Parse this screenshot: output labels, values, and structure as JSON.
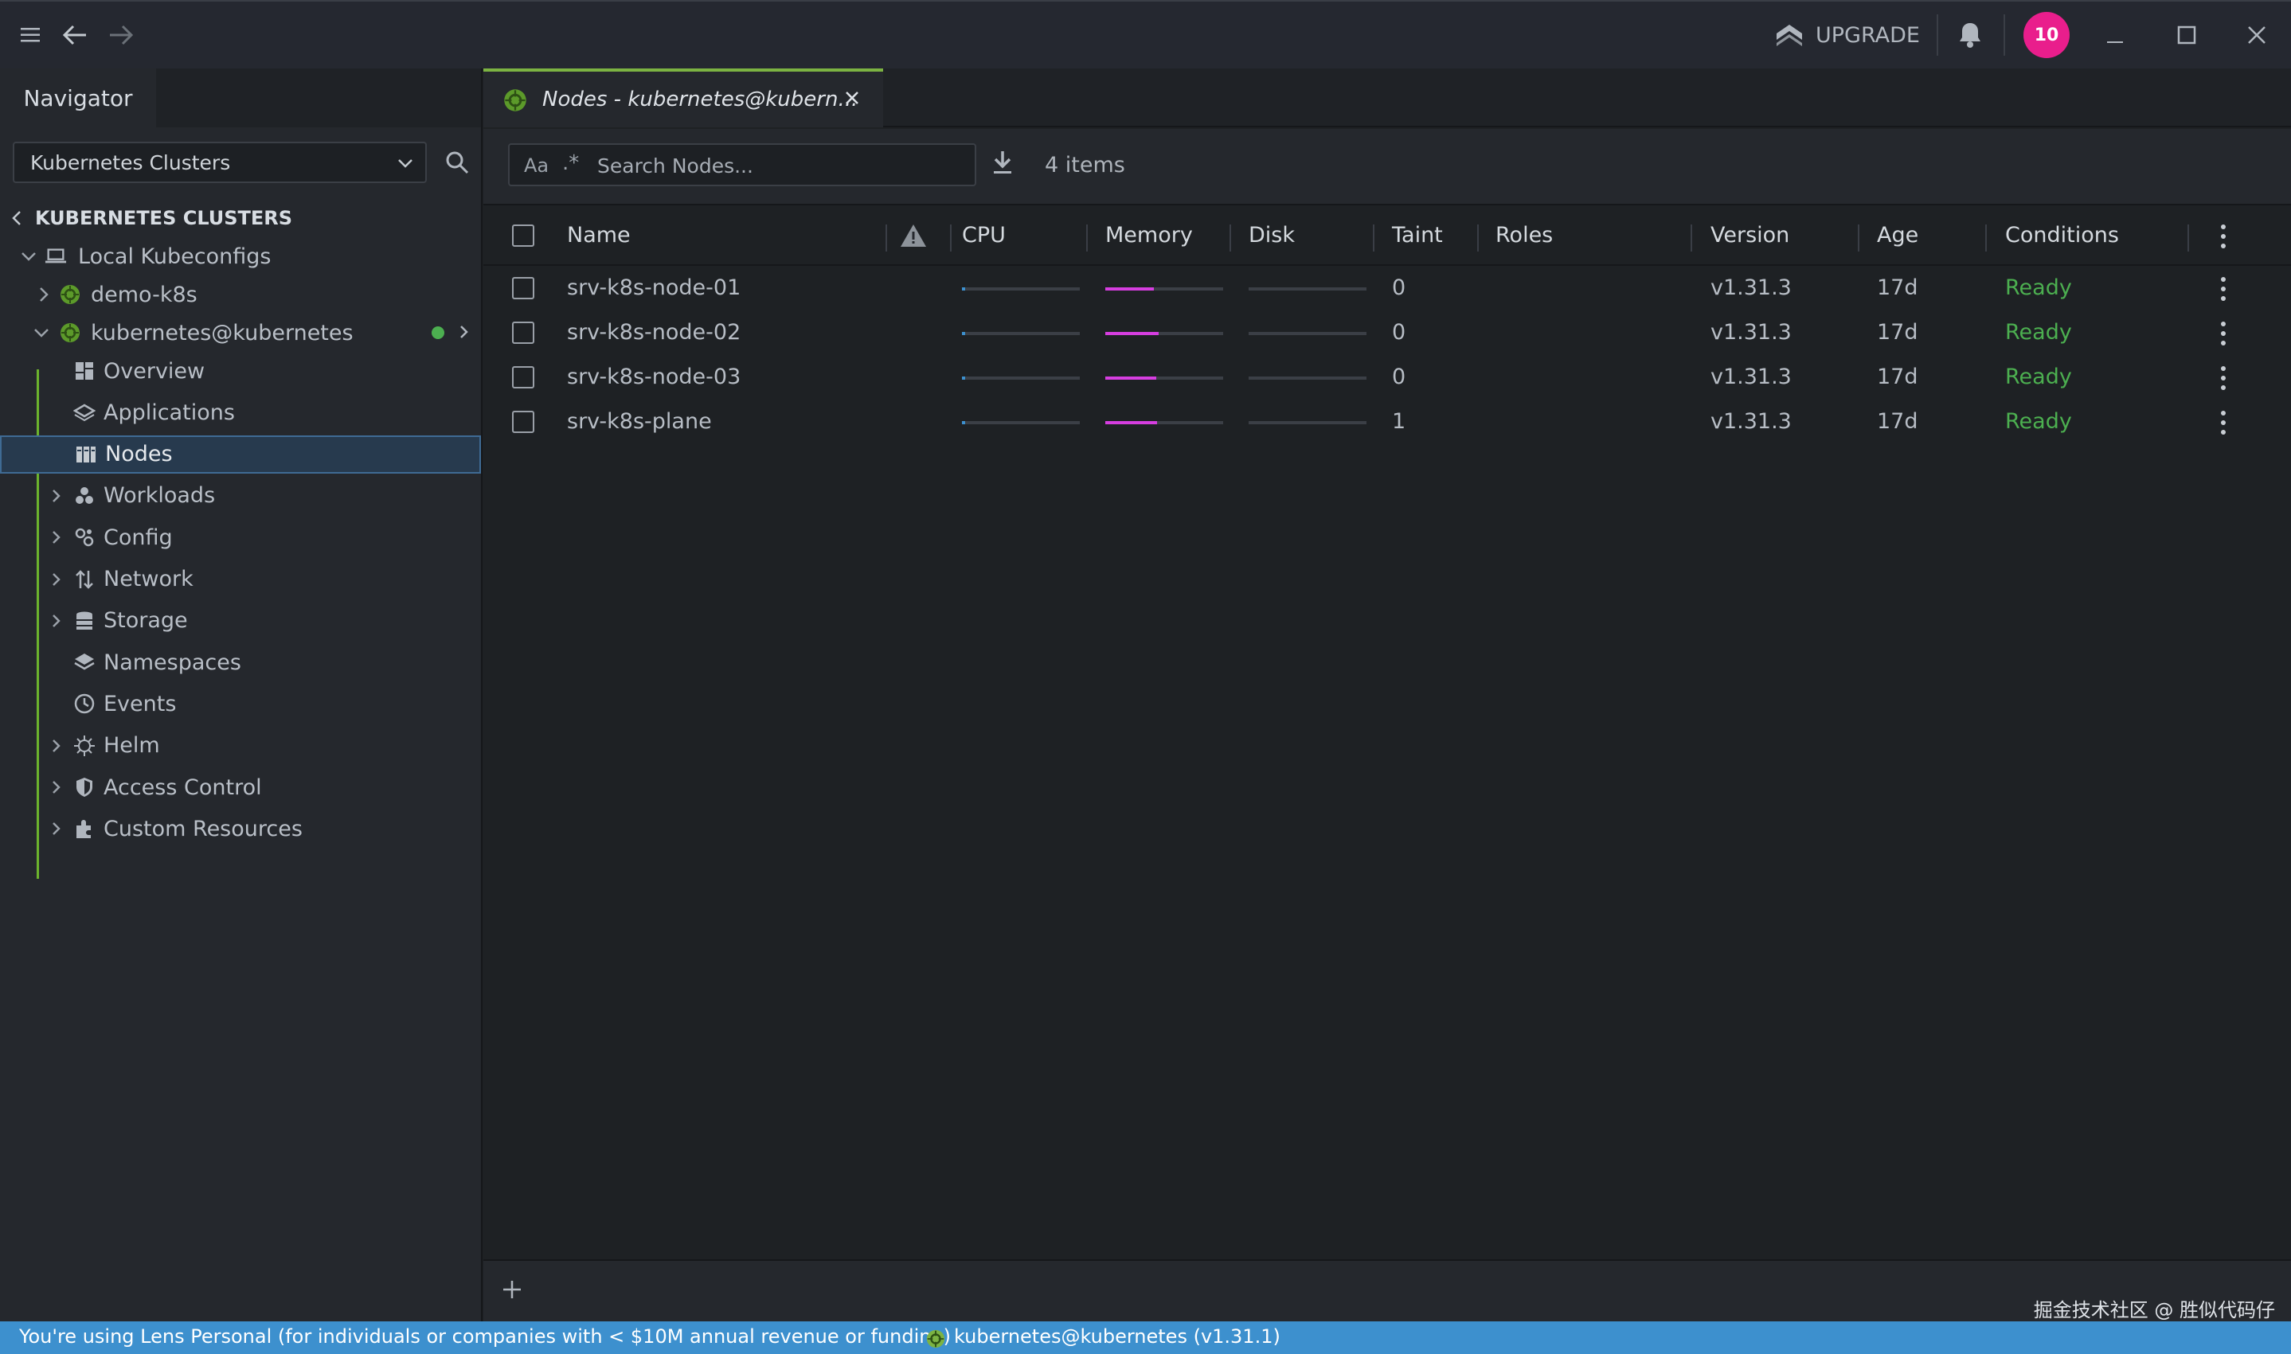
{
  "titlebar": {
    "upgrade_label": "UPGRADE",
    "notifications_count": "10"
  },
  "navigator": {
    "tab_label": "Navigator",
    "cluster_select_value": "Kubernetes Clusters",
    "tree": {
      "section_label": "KUBERNETES CLUSTERS",
      "local_kubeconfigs": "Local Kubeconfigs",
      "demo_cluster": "demo-k8s",
      "active_cluster": "kubernetes@kubernetes",
      "items": [
        {
          "label": "Overview",
          "icon": "overview-icon"
        },
        {
          "label": "Applications",
          "icon": "applications-icon"
        },
        {
          "label": "Nodes",
          "icon": "nodes-icon",
          "selected": true
        },
        {
          "label": "Workloads",
          "icon": "workloads-icon"
        },
        {
          "label": "Config",
          "icon": "config-icon"
        },
        {
          "label": "Network",
          "icon": "network-icon"
        },
        {
          "label": "Storage",
          "icon": "storage-icon"
        },
        {
          "label": "Namespaces",
          "icon": "namespaces-icon"
        },
        {
          "label": "Events",
          "icon": "events-icon"
        },
        {
          "label": "Helm",
          "icon": "helm-icon"
        },
        {
          "label": "Access Control",
          "icon": "access-control-icon"
        },
        {
          "label": "Custom Resources",
          "icon": "custom-resources-icon"
        }
      ]
    }
  },
  "main": {
    "tab_label": "Nodes - kubernetes@kubern...",
    "search_placeholder": "Search Nodes...",
    "search_case_label": "Aa",
    "search_regex_label": ".*",
    "items_count": "4 items",
    "columns": [
      "Name",
      "CPU",
      "Memory",
      "Disk",
      "Taint",
      "Roles",
      "Version",
      "Age",
      "Conditions"
    ],
    "rows": [
      {
        "name": "srv-k8s-node-01",
        "cpu": 0.02,
        "memory": 0.41,
        "disk": 0.0,
        "taint": "0",
        "roles": "",
        "version": "v1.31.3",
        "age": "17d",
        "conditions": "Ready"
      },
      {
        "name": "srv-k8s-node-02",
        "cpu": 0.02,
        "memory": 0.45,
        "disk": 0.0,
        "taint": "0",
        "roles": "",
        "version": "v1.31.3",
        "age": "17d",
        "conditions": "Ready"
      },
      {
        "name": "srv-k8s-node-03",
        "cpu": 0.02,
        "memory": 0.43,
        "disk": 0.0,
        "taint": "0",
        "roles": "",
        "version": "v1.31.3",
        "age": "17d",
        "conditions": "Ready"
      },
      {
        "name": "srv-k8s-plane",
        "cpu": 0.02,
        "memory": 0.44,
        "disk": 0.0,
        "taint": "1",
        "roles": "",
        "version": "v1.31.3",
        "age": "17d",
        "conditions": "Ready"
      }
    ],
    "watermark": "掘金技术社区 @ 胜似代码仔"
  },
  "statusbar": {
    "license_text": "You're using Lens Personal (for individuals or companies with < $10M annual revenue or funding)",
    "cluster_text": "kubernetes@kubernetes (v1.31.1)"
  },
  "colors": {
    "accent_green": "#7cb342",
    "ready_green": "#4caf50",
    "memory_bar": "#d63ee0",
    "cpu_bar": "#3d90ce",
    "statusbar_blue": "#3d90ce",
    "avatar_pink": "#e91e8c"
  }
}
